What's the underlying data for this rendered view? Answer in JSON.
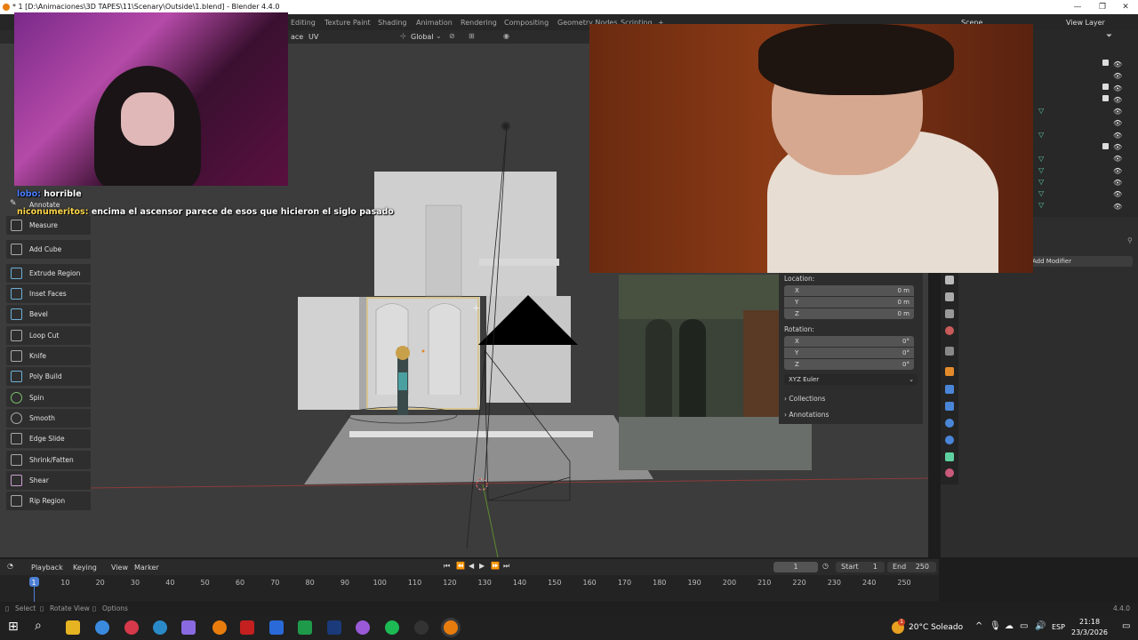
{
  "window": {
    "title": "* 1 [D:\\Animaciones\\3D TAPES\\11\\Scenary\\Outside\\1.blend] - Blender 4.4.0",
    "controls": [
      "—",
      "❐",
      "✕"
    ]
  },
  "workspace_tabs": [
    "Editing",
    "Texture Paint",
    "Shading",
    "Animation",
    "Rendering",
    "Compositing",
    "Geometry Nodes",
    "Scripting",
    "+"
  ],
  "scene": {
    "label": "Scene",
    "view_layer": "View Layer"
  },
  "viewport_header": {
    "menus": [
      "ace",
      "UV"
    ],
    "transform_orientation": "Global"
  },
  "toolbar": {
    "items": [
      "Annotate",
      "Measure",
      "Add Cube",
      "Extrude Region",
      "Inset Faces",
      "Bevel",
      "Loop Cut",
      "Knife",
      "Poly Build",
      "Spin",
      "Smooth",
      "Edge Slide",
      "Shrink/Fatten",
      "Shear",
      "Rip Region"
    ]
  },
  "chat": [
    {
      "user": "lobo:",
      "message": "horrible",
      "user_color": "#4a7dff"
    },
    {
      "user": "niconumeritos:",
      "message": "encima el ascensor parece de esos que hicieron el siglo pasado",
      "user_color": "#ffd84a"
    }
  ],
  "properties": {
    "add_modifier": "Add Modifier",
    "location_label": "Location:",
    "location": [
      {
        "axis": "X",
        "value": "0 m"
      },
      {
        "axis": "Y",
        "value": "0 m"
      },
      {
        "axis": "Z",
        "value": "0 m"
      }
    ],
    "rotation_label": "Rotation:",
    "rotation": [
      {
        "axis": "X",
        "value": "0°"
      },
      {
        "axis": "Y",
        "value": "0°"
      },
      {
        "axis": "Z",
        "value": "0°"
      }
    ],
    "rotation_mode": "XYZ Euler",
    "sections": [
      "Collections",
      "Annotations"
    ]
  },
  "timeline": {
    "menus": [
      "Playback",
      "Keying",
      "View",
      "Marker"
    ],
    "current_frame": "1",
    "start_label": "Start",
    "start": "1",
    "end_label": "End",
    "end": "250",
    "ticks": [
      "1",
      "10",
      "20",
      "30",
      "40",
      "50",
      "60",
      "70",
      "80",
      "90",
      "100",
      "110",
      "120",
      "130",
      "140",
      "150",
      "160",
      "170",
      "180",
      "190",
      "200",
      "210",
      "220",
      "230",
      "240",
      "250"
    ]
  },
  "statusbar": {
    "select": "Select",
    "rotate_view": "Rotate View",
    "options": "Options",
    "version": "4.4.0"
  },
  "taskbar": {
    "weather": "20°C  Soleado",
    "language": "ESP",
    "time": "21:18",
    "date": "23/3/2026",
    "weather_badge": "1"
  }
}
